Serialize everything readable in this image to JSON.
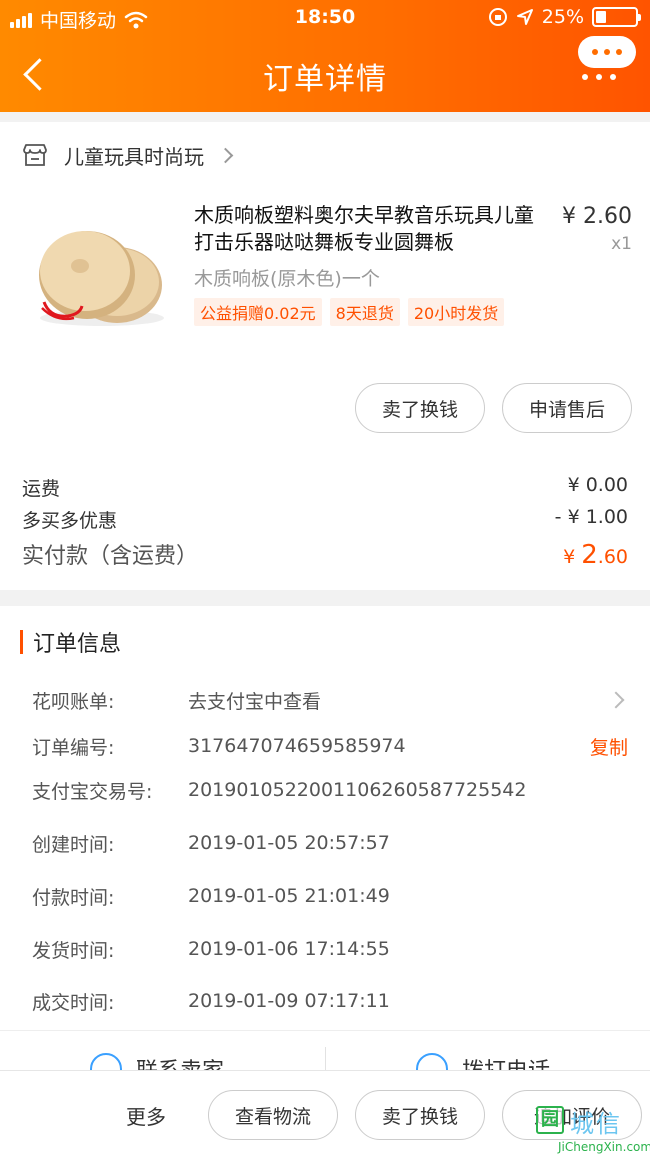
{
  "status_bar": {
    "carrier": "中国移动",
    "time": "18:50",
    "battery": "25%",
    "battery_level": 0.25
  },
  "nav": {
    "title": "订单详情"
  },
  "shop": {
    "name": "儿童玩具时尚玩"
  },
  "product": {
    "title": "木质响板塑料奥尔夫早教音乐玩具儿童打击乐器哒哒舞板专业圆舞板",
    "sku": "木质响板(原木色)一个",
    "price": "¥ 2.60",
    "quantity": "x1",
    "tags": [
      "公益捐赠0.02元",
      "8天退货",
      "20小时发货"
    ]
  },
  "item_actions": {
    "sell_label": "卖了换钱",
    "after_sale_label": "申请售后"
  },
  "fees": {
    "shipping_label": "运费",
    "shipping_value": "¥ 0.00",
    "discount_label": "多买多优惠",
    "discount_value": "- ¥ 1.00",
    "total_label": "实付款（含运费）",
    "total_currency": "¥ ",
    "total_int": "2",
    "total_dec": ".60"
  },
  "order_info": {
    "heading": "订单信息",
    "rows": [
      {
        "label": "花呗账单:",
        "value": "去支付宝中查看"
      },
      {
        "label": "订单编号:",
        "value": "317647074659585974",
        "action": "复制"
      },
      {
        "label": "支付宝交易号:",
        "value": "2019010522001106260587725542"
      },
      {
        "label": "创建时间:",
        "value": "2019-01-05 20:57:57"
      },
      {
        "label": "付款时间:",
        "value": "2019-01-05 21:01:49"
      },
      {
        "label": "发货时间:",
        "value": "2019-01-06 17:14:55"
      },
      {
        "label": "成交时间:",
        "value": "2019-01-09 07:17:11"
      }
    ]
  },
  "contact": {
    "seller_label": "联系卖家",
    "phone_label": "拨打电话"
  },
  "bottom_bar": {
    "more_label": "更多",
    "logistics_label": "查看物流",
    "sell_label": "卖了换钱",
    "review_label": "追加评价"
  },
  "watermark": {
    "box_char": "园",
    "text": "城信",
    "sub": "JiChengXin.com"
  },
  "colors": {
    "accent": "#ff5000",
    "header_from": "#ff8a00",
    "header_to": "#ff5400"
  }
}
